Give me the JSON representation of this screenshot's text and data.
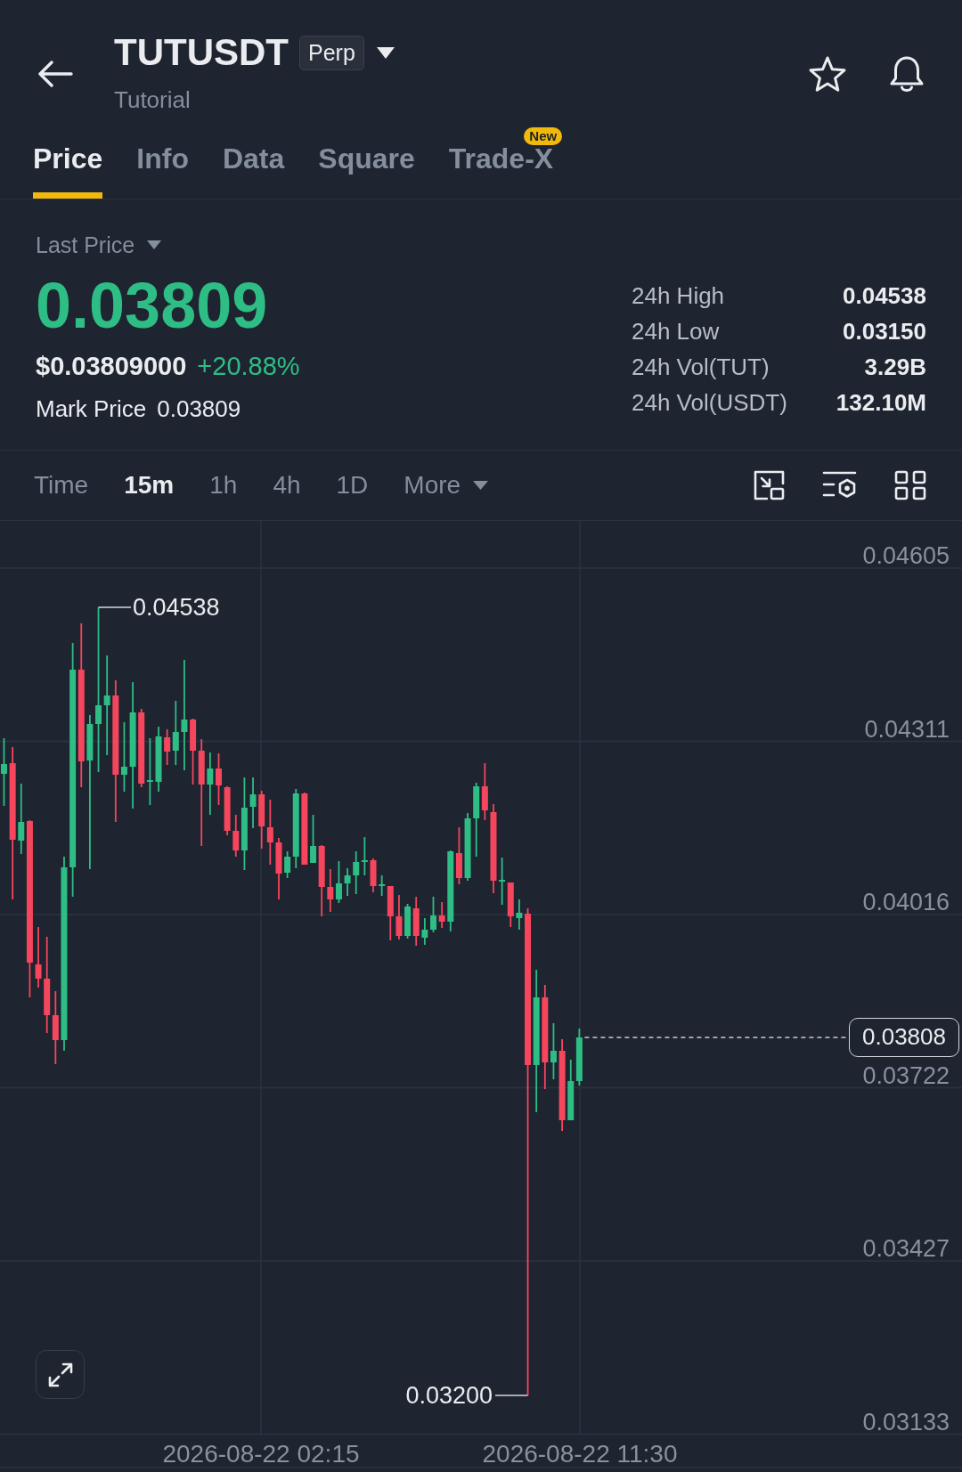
{
  "header": {
    "title": "TUTUSDT",
    "badge": "Perp",
    "subtitle": "Tutorial"
  },
  "tabs": [
    {
      "label": "Price",
      "selected": true
    },
    {
      "label": "Info",
      "selected": false
    },
    {
      "label": "Data",
      "selected": false
    },
    {
      "label": "Square",
      "selected": false
    },
    {
      "label": "Trade-X",
      "selected": false,
      "badge": "New"
    }
  ],
  "price": {
    "selector": "Last Price",
    "last": "0.03809",
    "usd": "$0.03809000",
    "change": "+20.88%",
    "mark_label": "Mark Price",
    "mark_value": "0.03809"
  },
  "stats": [
    {
      "label": "24h High",
      "value": "0.04538"
    },
    {
      "label": "24h Low",
      "value": "0.03150"
    },
    {
      "label": "24h Vol(TUT)",
      "value": "3.29B"
    },
    {
      "label": "24h Vol(USDT)",
      "value": "132.10M"
    }
  ],
  "intervals": [
    {
      "label": "Time",
      "kind": "option",
      "selected": false
    },
    {
      "label": "15m",
      "kind": "option",
      "selected": true
    },
    {
      "label": "1h",
      "kind": "option",
      "selected": false
    },
    {
      "label": "4h",
      "kind": "option",
      "selected": false
    },
    {
      "label": "1D",
      "kind": "option",
      "selected": false
    },
    {
      "label": "More",
      "kind": "menu",
      "selected": false
    }
  ],
  "chart": {
    "price_ticks": [
      "0.04605",
      "0.04311",
      "0.04016",
      "0.03722",
      "0.03427",
      "0.03133"
    ],
    "time_labels": [
      "2026-08-22 02:15",
      "2026-08-22 11:30"
    ],
    "high_label": "0.04538",
    "low_label": "0.03200",
    "current_price": "0.03808"
  }
}
